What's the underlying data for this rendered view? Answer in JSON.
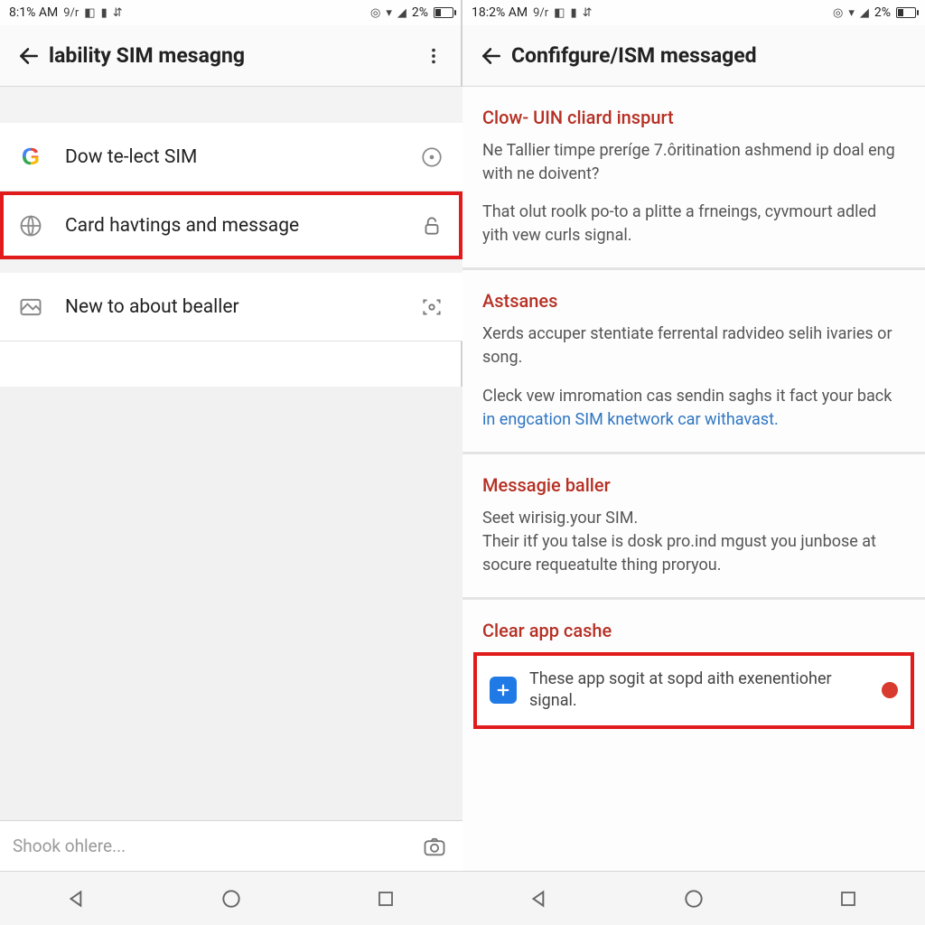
{
  "status": {
    "left_time_a": "8:1%  AM",
    "left_time_b": "18:2%  AM",
    "tag": "9/r",
    "batt_pct": "2%"
  },
  "left": {
    "title": "lability SIM mesagng",
    "rows": [
      {
        "label": "Dow te-lect SIM"
      },
      {
        "label": "Card havtings and message"
      },
      {
        "label": "New to about bealler"
      }
    ],
    "search_placeholder": "Shook ohlere..."
  },
  "right": {
    "title": "Confifgure/ISM messaged",
    "s1_title": "Clow- UIN cliard inspurt",
    "s1_body": "Ne Tallier timpe preríge 7.ôritination ashmend ip doal eng with ne doivent?",
    "s1_sub": "That olut roolk po-to a plitte a frneings, cyvmourt adled yith vew curls signal.",
    "s2_title": "Astsanes",
    "s2_body": "Xerds accuper stentiate ferrental radvideo selih ivaries or song.",
    "s2_sub_pre": "Cleck vew imromation cas sendin saghs it fact your back ",
    "s2_link": "in engcation SIM knetwork car withavast.",
    "s3_title": "Messagie baller",
    "s3_body": "Seet wirisig.your SIM.\nTheir itf you talse is dosk pro.ind mgust you junbose at socure requeatulte thing proryou.",
    "s4_title": "Clear app cashe",
    "s4_body": "These app sogit at sopd aith exenentioher signal."
  }
}
